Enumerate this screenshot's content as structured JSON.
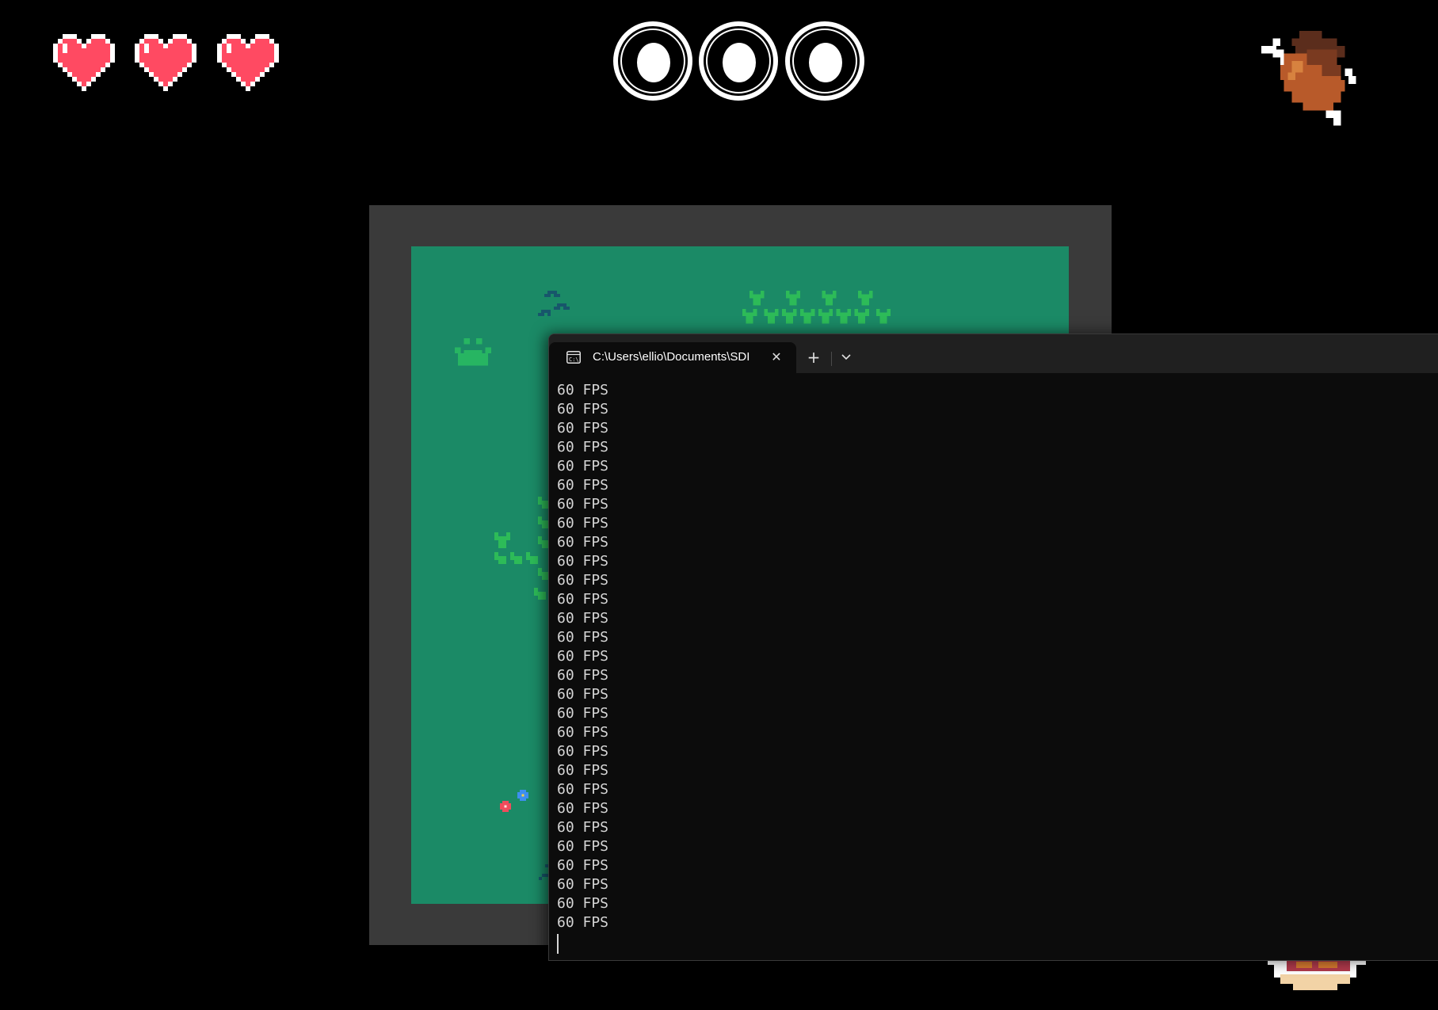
{
  "hud": {
    "hearts": {
      "icon": "heart-icon",
      "count": 3,
      "color": "#ff4a62"
    },
    "eggs": {
      "icon": "egg-slot-icon",
      "count": 3
    },
    "food_item": "roast-meat-icon"
  },
  "game": {
    "border_color": "#3a3a3a",
    "grass_color": "#1b8a66"
  },
  "terminal": {
    "tab_title": "C:\\Users\\ellio\\Documents\\SDI",
    "close_glyph": "✕",
    "new_tab_glyph": "+",
    "lines": [
      "60 FPS",
      "60 FPS",
      "60 FPS",
      "60 FPS",
      "60 FPS",
      "60 FPS",
      "60 FPS",
      "60 FPS",
      "60 FPS",
      "60 FPS",
      "60 FPS",
      "60 FPS",
      "60 FPS",
      "60 FPS",
      "60 FPS",
      "60 FPS",
      "60 FPS",
      "60 FPS",
      "60 FPS",
      "60 FPS",
      "60 FPS",
      "60 FPS",
      "60 FPS",
      "60 FPS",
      "60 FPS",
      "60 FPS",
      "60 FPS",
      "60 FPS",
      "60 FPS"
    ]
  }
}
